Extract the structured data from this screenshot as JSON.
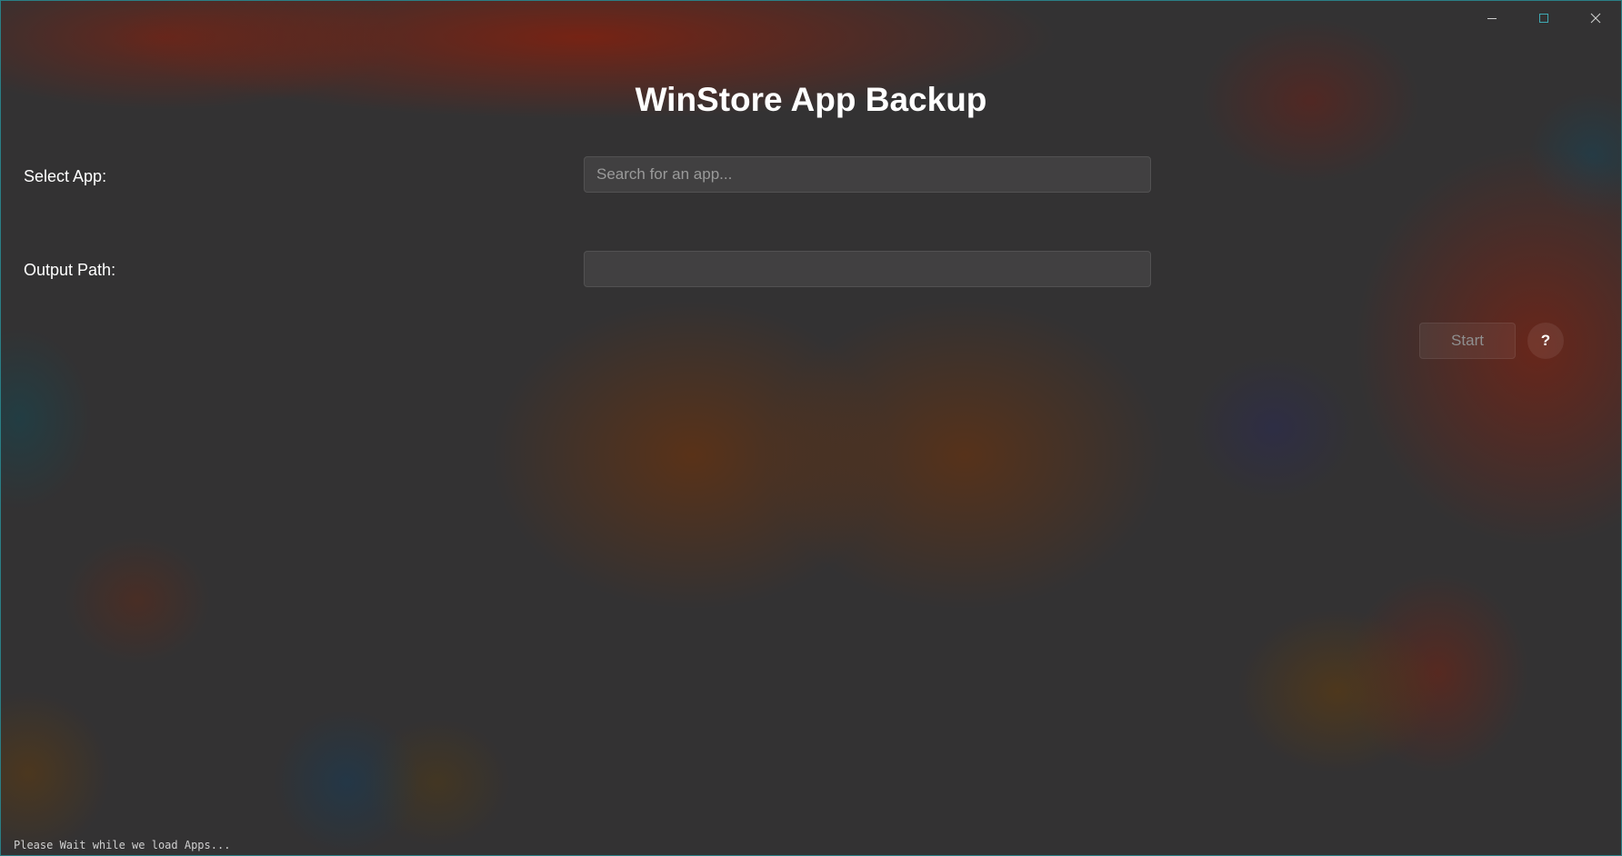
{
  "window": {
    "title": "WinStore App Backup",
    "controls": {
      "minimize_icon": "minimize-icon",
      "maximize_icon": "maximize-icon",
      "close_icon": "close-icon"
    },
    "accent_color": "#2a7f86"
  },
  "form": {
    "select_app_label": "Select App:",
    "search_placeholder": "Search for an app...",
    "search_value": "",
    "output_path_label": "Output Path:",
    "output_path_value": ""
  },
  "actions": {
    "start_label": "Start",
    "help_label": "?"
  },
  "status_bar": {
    "message": "Please Wait while we load Apps..."
  }
}
